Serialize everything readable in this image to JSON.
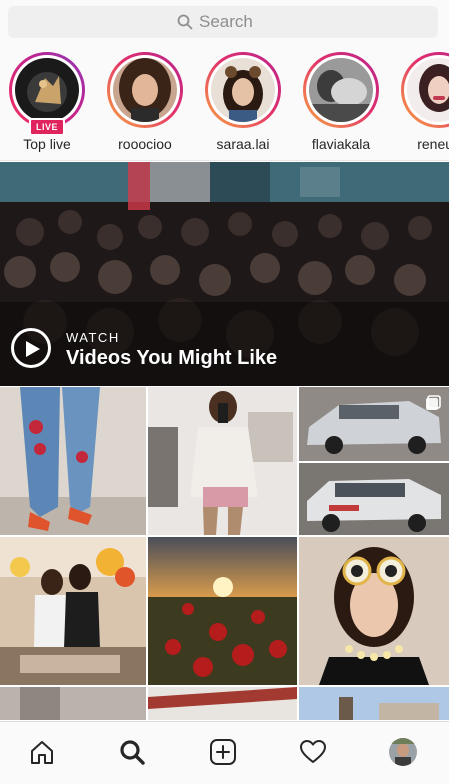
{
  "search": {
    "placeholder": "Search",
    "icon": "search-icon"
  },
  "stories": [
    {
      "name": "Top live",
      "badge": "LIVE"
    },
    {
      "name": "rooocioo"
    },
    {
      "name": "saraa.lai"
    },
    {
      "name": "flaviakala"
    },
    {
      "name": "reneug"
    }
  ],
  "feature": {
    "eyebrow": "WATCH",
    "title": "Videos You Might Like"
  },
  "nav": {
    "items": [
      "home-icon",
      "search-icon",
      "new-post-icon",
      "activity-heart-icon",
      "profile-avatar"
    ],
    "active": "search-icon"
  },
  "colors": {
    "live_badge": "#e0245e",
    "ring_start": "#f9a740",
    "ring_end": "#b7238e"
  }
}
